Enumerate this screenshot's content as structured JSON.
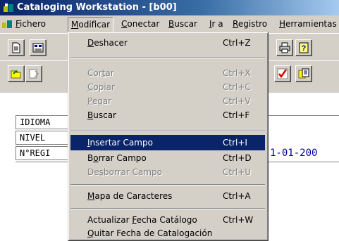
{
  "window": {
    "title": "Cataloging Workstation - [b00]"
  },
  "menubar": {
    "items": [
      {
        "label": "Fichero",
        "mnemonic": "F",
        "rest": "ichero"
      },
      {
        "label": "Modificar",
        "mnemonic": "M",
        "rest": "odificar"
      },
      {
        "label": "Conectar",
        "mnemonic": "C",
        "rest": "onectar"
      },
      {
        "label": "Buscar",
        "mnemonic": "B",
        "rest": "uscar"
      },
      {
        "label": "Ir a",
        "mnemonic": "I",
        "rest": "r a"
      },
      {
        "label": "Registro",
        "mnemonic": "R",
        "rest": "egistro"
      },
      {
        "label": "Herramientas",
        "mnemonic": "H",
        "rest": "erramientas"
      }
    ]
  },
  "record": {
    "fields": [
      {
        "label": "IDIOMA"
      },
      {
        "label": "NIVEL"
      },
      {
        "label": "N°REGI"
      }
    ],
    "date_fragment": "1-01-200"
  },
  "modificar_menu": {
    "items": [
      {
        "pre": "",
        "mn": "D",
        "post": "eshacer",
        "shortcut": "Ctrl+Z",
        "state": "enabled"
      },
      {
        "pre": "Cor",
        "mn": "t",
        "post": "ar",
        "shortcut": "Ctrl+X",
        "state": "disabled"
      },
      {
        "pre": "",
        "mn": "C",
        "post": "opiar",
        "shortcut": "Ctrl+C",
        "state": "disabled"
      },
      {
        "pre": "",
        "mn": "P",
        "post": "egar",
        "shortcut": "Ctrl+V",
        "state": "disabled"
      },
      {
        "pre": "",
        "mn": "B",
        "post": "uscar",
        "shortcut": "Ctrl+F",
        "state": "enabled"
      },
      {
        "pre": "",
        "mn": "I",
        "post": "nsertar Campo",
        "shortcut": "Ctrl+I",
        "state": "highlighted"
      },
      {
        "pre": "B",
        "mn": "o",
        "post": "rrar Campo",
        "shortcut": "Ctrl+D",
        "state": "enabled"
      },
      {
        "pre": "De",
        "mn": "s",
        "post": "borrar Campo",
        "shortcut": "Ctrl+U",
        "state": "disabled"
      },
      {
        "pre": "",
        "mn": "M",
        "post": "apa de Caracteres",
        "shortcut": "Ctrl+A",
        "state": "enabled"
      },
      {
        "pre": "Actualizar ",
        "mn": "F",
        "post": "echa Catálogo",
        "shortcut": "Ctrl+W",
        "state": "enabled"
      },
      {
        "pre": "",
        "mn": "Q",
        "post": "uitar Fecha de Catalogación",
        "shortcut": "",
        "state": "enabled"
      }
    ]
  },
  "colors": {
    "title_bar": "#0a246a",
    "menu_highlight": "#0a246a",
    "face": "#d4d0c8",
    "date_text": "#0000a0"
  },
  "icons": [
    "app-icon",
    "document-icon",
    "records-icon",
    "printer-icon",
    "help-icon",
    "open-folder-icon",
    "edit-icon",
    "validate-checkmark-icon",
    "copy-card-icon"
  ]
}
